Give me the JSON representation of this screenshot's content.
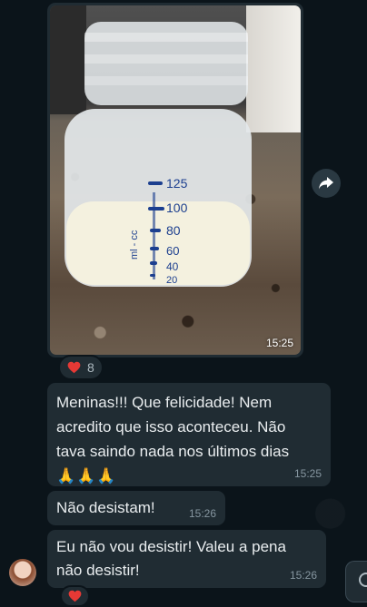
{
  "chat": {
    "image_message": {
      "time": "15:25",
      "bottle_marks": [
        "125",
        "100",
        "80",
        "60",
        "40",
        "20"
      ],
      "bottle_unit": "ml - cc",
      "reaction": {
        "emoji": "heart-icon",
        "count": "8"
      }
    },
    "messages": [
      {
        "lines": [
          "Meninas!!! Que felicidade! Nem",
          "acredito que isso aconteceu. Não",
          "tava saindo nada nos últimos dias"
        ],
        "emoji": "🙏🙏🙏",
        "time": "15:25"
      },
      {
        "text": "Não desistam!",
        "time": "15:26"
      },
      {
        "lines": [
          "Eu não vou desistir! Valeu a pena",
          "não desistir!"
        ],
        "time": "15:26",
        "reaction": {
          "emoji": "heart-icon"
        }
      }
    ]
  },
  "colors": {
    "background": "#0b141a",
    "bubble": "#202c33",
    "text": "#e9edef",
    "timestamp": "#8696a0",
    "heart": "#e53935"
  }
}
